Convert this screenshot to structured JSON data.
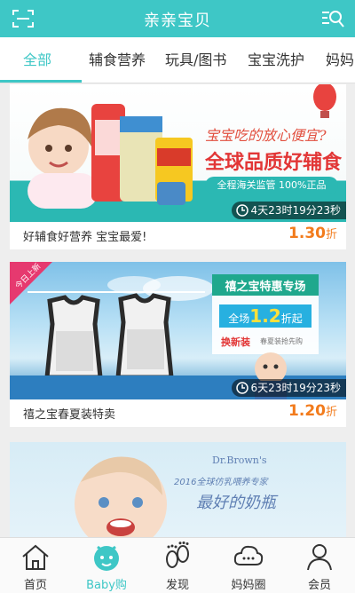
{
  "header": {
    "title": "亲亲宝贝"
  },
  "tabs": [
    {
      "label": "全部"
    },
    {
      "label": "辅食营养"
    },
    {
      "label": "玩具/图书"
    },
    {
      "label": "宝宝洗护"
    },
    {
      "label": "妈妈"
    }
  ],
  "cards": [
    {
      "banner_text": {
        "headline": "宝宝吃的放心便宜?",
        "slogan": "全球品质好辅食",
        "badge": "全程海关监管 100%正品"
      },
      "countdown": "4天23时19分23秒",
      "desc": "好辅食好营养 宝宝最爱!",
      "price": "1.30",
      "price_unit": "折"
    },
    {
      "banner_text": {
        "corner_tag": "今日上新",
        "promo_title": "禧之宝特惠专场",
        "promo_prefix": "全场",
        "promo_value": "1.2",
        "promo_suffix": "折起",
        "new_arrival": "换新装",
        "new_arrival_sub": "春夏装抢先购"
      },
      "countdown": "6天23时19分23秒",
      "desc": "禧之宝春夏装特卖",
      "price": "1.20",
      "price_unit": "折"
    },
    {
      "banner_text": {
        "brand": "Dr.Brown's",
        "tagline": "2016全球仿乳喂养专家",
        "tagline2": "最好的奶瓶"
      }
    }
  ],
  "bottom_nav": [
    {
      "label": "首页",
      "icon": "home-icon"
    },
    {
      "label": "Baby购",
      "icon": "baby-shop-icon"
    },
    {
      "label": "发现",
      "icon": "footprints-icon"
    },
    {
      "label": "妈妈圈",
      "icon": "chat-cloud-icon"
    },
    {
      "label": "会员",
      "icon": "person-icon"
    }
  ],
  "colors": {
    "brand": "#3ec7c6",
    "price": "#f27b1c"
  }
}
